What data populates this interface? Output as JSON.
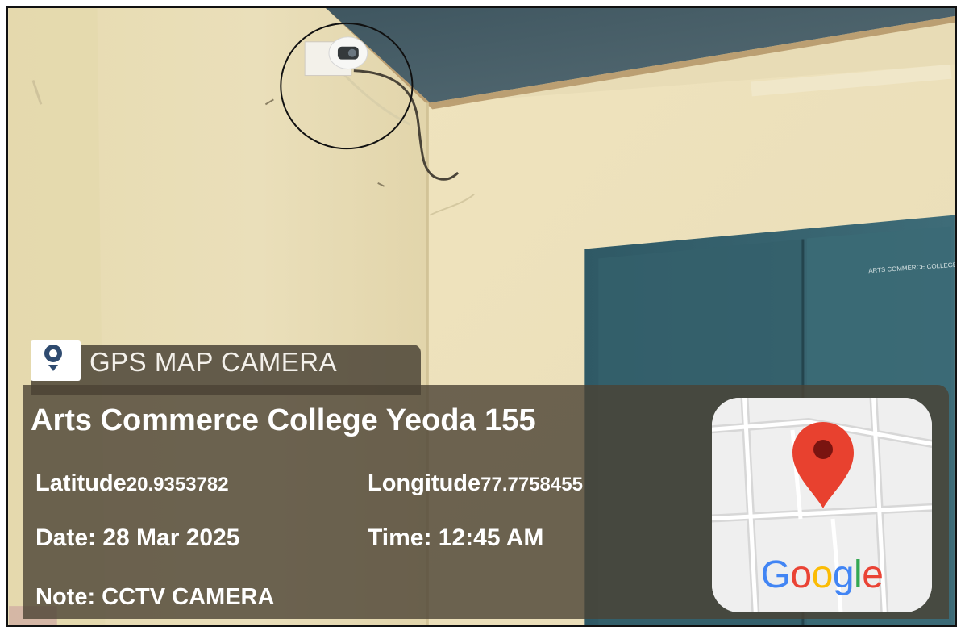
{
  "overlay": {
    "brand": "GPS MAP CAMERA",
    "place": "Arts Commerce College Yeoda 155",
    "latitude_label": "Latitude",
    "latitude_value": "20.9353782",
    "longitude_label": "Longitude",
    "longitude_value": "77.7758455",
    "date": "Date: 28 Mar 2025",
    "time": "Time: 12:45 AM",
    "note": "Note: CCTV CAMERA"
  },
  "scene": {
    "cabinet_label": "ARTS COMMERCE COLLEGE"
  },
  "map_tile": {
    "google_letters": [
      {
        "ch": "G",
        "color": "#4285F4"
      },
      {
        "ch": "o",
        "color": "#EA4335"
      },
      {
        "ch": "o",
        "color": "#FBBC05"
      },
      {
        "ch": "g",
        "color": "#4285F4"
      },
      {
        "ch": "l",
        "color": "#34A853"
      },
      {
        "ch": "e",
        "color": "#EA4335"
      }
    ],
    "pin_color": "#E8412F",
    "pin_dot_color": "#7A1410"
  }
}
